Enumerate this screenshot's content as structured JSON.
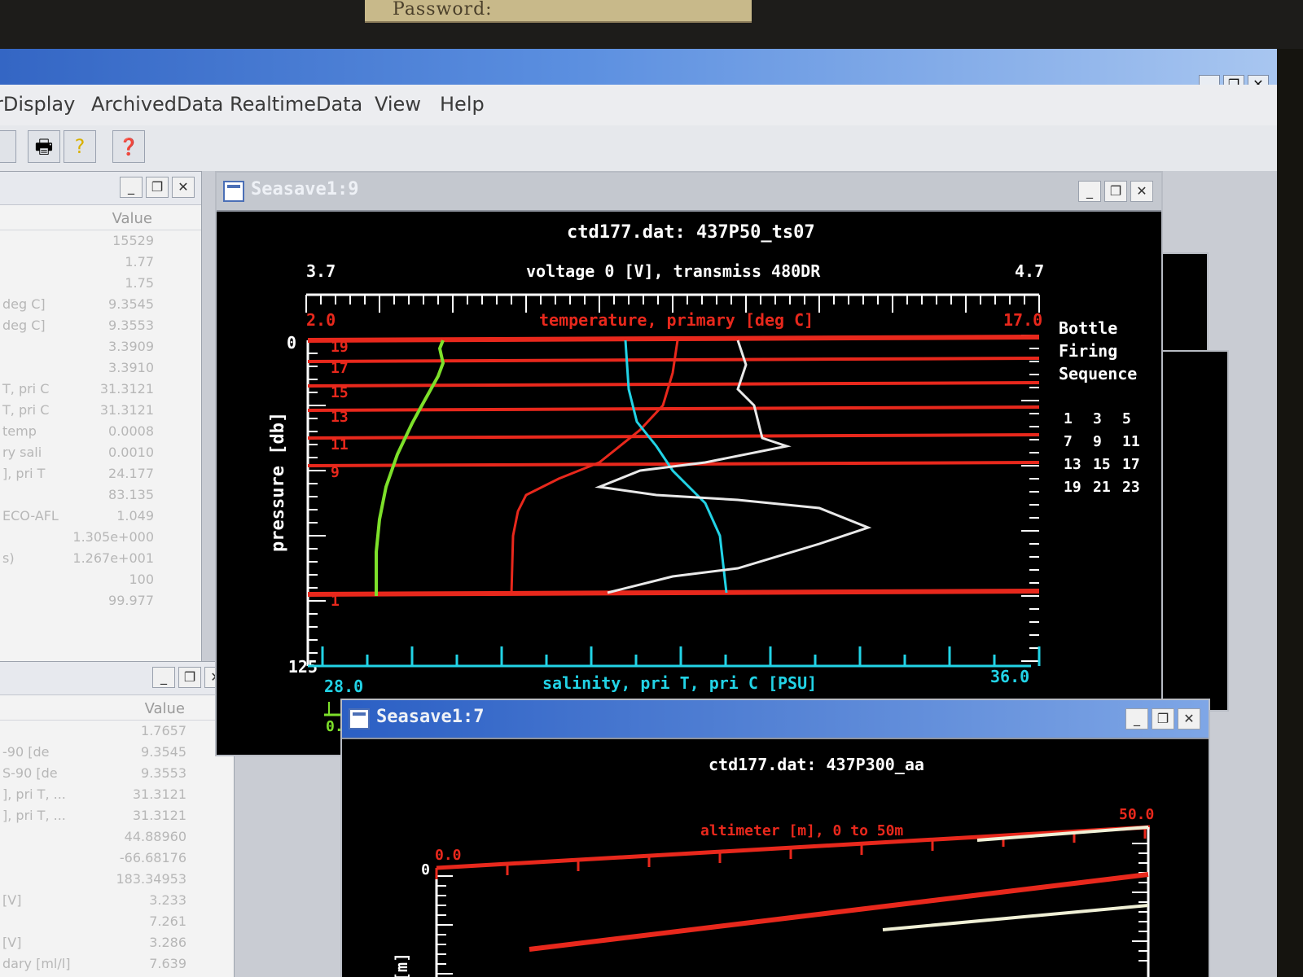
{
  "sticky_note": {
    "text": "Password:",
    "smudge": ""
  },
  "window_buttons": {
    "minimize": "_",
    "restore": "❐",
    "close": "✕"
  },
  "menu": {
    "items": [
      "rDisplay",
      "ArchivedData",
      "RealtimeData",
      "View",
      "Help"
    ]
  },
  "toolbar": {
    "print_icon": "🖶",
    "help_icon": "?",
    "context_help_icon": "❓"
  },
  "side_panel_top": {
    "value_header": "Value",
    "rows": [
      {
        "label": "",
        "value": "15529"
      },
      {
        "label": "",
        "value": "1.77"
      },
      {
        "label": "",
        "value": "1.75"
      },
      {
        "label": "deg C]",
        "value": "9.3545"
      },
      {
        "label": "deg C]",
        "value": "9.3553"
      },
      {
        "label": "",
        "value": "3.3909"
      },
      {
        "label": "",
        "value": "3.3910"
      },
      {
        "label": "T, pri C",
        "value": "31.3121"
      },
      {
        "label": "T, pri C",
        "value": "31.3121"
      },
      {
        "label": "temp",
        "value": "0.0008"
      },
      {
        "label": "ry sali",
        "value": "0.0010"
      },
      {
        "label": "], pri T",
        "value": "24.177"
      },
      {
        "label": "",
        "value": "83.135"
      },
      {
        "label": "ECO-AFL",
        "value": "1.049"
      },
      {
        "label": "",
        "value": "1.305e+000"
      },
      {
        "label": "s)",
        "value": "1.267e+001"
      },
      {
        "label": "",
        "value": "100"
      },
      {
        "label": "",
        "value": "99.977"
      }
    ]
  },
  "side_panel_bottom": {
    "value_header": "Value",
    "rows": [
      {
        "label": "",
        "value": "1.7657"
      },
      {
        "label": "-90 [de",
        "value": "9.3545"
      },
      {
        "label": "S-90 [de",
        "value": "9.3553"
      },
      {
        "label": "], pri T, ...",
        "value": "31.3121"
      },
      {
        "label": "], pri T, ...",
        "value": "31.3121"
      },
      {
        "label": "",
        "value": "44.88960"
      },
      {
        "label": "",
        "value": "-66.68176"
      },
      {
        "label": "",
        "value": "183.34953"
      },
      {
        "label": "[V]",
        "value": "3.233"
      },
      {
        "label": "",
        "value": "7.261"
      },
      {
        "label": "[V]",
        "value": "3.286"
      },
      {
        "label": "dary [ml/l]",
        "value": "7.639"
      }
    ]
  },
  "plot_main": {
    "window_title": "Seasave1:9",
    "plot_title": "ctd177.dat: 437P50_ts07",
    "top_axis": {
      "label": "voltage 0 [V], transmiss 480DR",
      "min": "3.7",
      "max": "4.7"
    },
    "temp_axis": {
      "label": "temperature, primary [deg C]",
      "min": "2.0",
      "max": "17.0"
    },
    "bottom_axis": {
      "label": "salinity, pri T, pri C [PSU]",
      "min": "28.0",
      "max": "36.0"
    },
    "green_axis_min": "0.",
    "y_axis": {
      "label": "pressure [db]",
      "min": "0",
      "max": "125"
    },
    "bottle_legend": {
      "title": [
        "Bottle",
        "Firing",
        "Sequence"
      ],
      "numbers": [
        [
          "1",
          "3",
          "5"
        ],
        [
          "7",
          "9",
          "11"
        ],
        [
          "13",
          "15",
          "17"
        ],
        [
          "19",
          "21",
          "23"
        ]
      ]
    },
    "bottle_labels": [
      "19",
      "17",
      "15",
      "13",
      "11",
      "9",
      "1"
    ],
    "colors": {
      "temperature": "#e8281c",
      "salinity": "#22d3e6",
      "transmission": "#e9e9e9",
      "fluor": "#7de02a"
    }
  },
  "plot_second": {
    "window_title": "Seasave1:7",
    "plot_title": "ctd177.dat: 437P300_aa",
    "top_axis": {
      "label": "altimeter [m], 0 to 50m",
      "min": "0.0",
      "max": "50.0"
    },
    "y_axis": {
      "label": "[m]",
      "min": "0"
    }
  }
}
